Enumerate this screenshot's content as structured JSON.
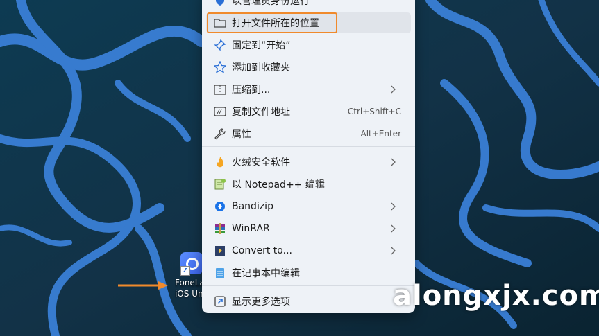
{
  "colors": {
    "menu_bg": "#eef2f7",
    "highlight_border": "#f08a2c",
    "arrow": "#f08a2c"
  },
  "menu": {
    "top_partial_label": "以管理员身份运行",
    "items": [
      {
        "label": "打开文件所在的位置",
        "icon": "folder-icon",
        "shortcut": ""
      },
      {
        "label": "固定到“开始”",
        "icon": "pin-icon",
        "shortcut": ""
      },
      {
        "label": "添加到收藏夹",
        "icon": "star-icon",
        "shortcut": ""
      },
      {
        "label": "压缩到...",
        "icon": "zip-folder-icon",
        "shortcut": ""
      },
      {
        "label": "复制文件地址",
        "icon": "copy-path-icon",
        "shortcut": "Ctrl+Shift+C"
      },
      {
        "label": "属性",
        "icon": "wrench-icon",
        "shortcut": "Alt+Enter"
      },
      {
        "label": "火绒安全软件",
        "icon": "huorong-icon",
        "shortcut": ""
      },
      {
        "label": "以 Notepad++ 编辑",
        "icon": "notepadpp-icon",
        "shortcut": ""
      },
      {
        "label": "Bandizip",
        "icon": "bandizip-icon",
        "shortcut": ""
      },
      {
        "label": "WinRAR",
        "icon": "winrar-icon",
        "shortcut": ""
      },
      {
        "label": "Convert to...",
        "icon": "convert-icon",
        "shortcut": ""
      },
      {
        "label": "在记事本中编辑",
        "icon": "notepad-icon",
        "shortcut": ""
      },
      {
        "label": "显示更多选项",
        "icon": "more-options-icon",
        "shortcut": ""
      }
    ]
  },
  "desktop_icon": {
    "line1": "FoneLab",
    "line2": "iOS Unlocker"
  },
  "watermark": "alongxjx.com"
}
